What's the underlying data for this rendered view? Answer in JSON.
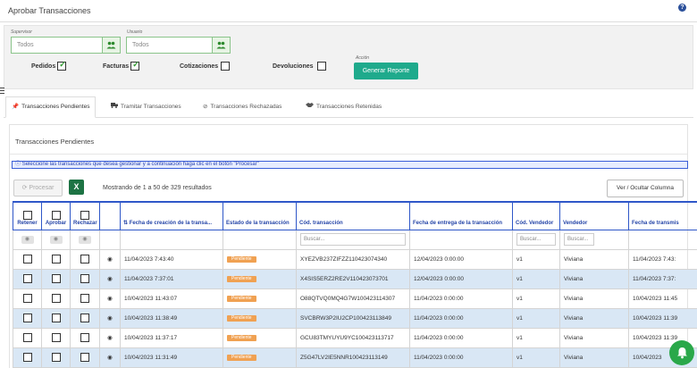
{
  "header": {
    "title": "Aprobar Transacciones",
    "help_glyph": "?"
  },
  "filters": {
    "supervisor": {
      "label": "Supervisor",
      "value": "Todos"
    },
    "usuario": {
      "label": "Usuario",
      "value": "Todos"
    },
    "checks": [
      {
        "label": "Pedidos",
        "checked": true
      },
      {
        "label": "Facturas",
        "checked": true
      },
      {
        "label": "Cotizaciones",
        "checked": false
      },
      {
        "label": "Devoluciones",
        "checked": false
      }
    ],
    "accion_label": "Acción",
    "generar_label": "Generar Reporte"
  },
  "tabs": [
    {
      "label": "Transacciones Pendientes",
      "icon": "pin-icon",
      "active": true
    },
    {
      "label": "Tramitar Transacciones",
      "icon": "truck-icon",
      "active": false
    },
    {
      "label": "Transacciones Rechazadas",
      "icon": "ban-icon",
      "active": false
    },
    {
      "label": "Transacciones Retenidas",
      "icon": "handshake-icon",
      "active": false
    }
  ],
  "panel": {
    "title": "Transacciones Pendientes",
    "info": "Seleccione las transacciones que desea gestionar y a continuación haga clic en el botón \"Procesar\"",
    "procesar_label": "Procesar",
    "excel_glyph": "X",
    "showing": "Mostrando de 1 a 50 de 329 resultados",
    "columns_button": "Ver / Ocultar Columna"
  },
  "table": {
    "headers": {
      "retener": "Retener",
      "aprobar": "Aprobar",
      "rechazar": "Rechazar",
      "fecha_creacion": "Fecha de creación de la transa...",
      "estado": "Estado de la transacción",
      "cod": "Cód. transacción",
      "fecha_entrega": "Fecha de entrega de la transacción",
      "cod_vendedor": "Cód. Vendedor",
      "vendedor": "Vendedor",
      "fecha_transmision": "Fecha de transmis"
    },
    "filter_placeholders": {
      "cod": "Buscar...",
      "cod_vendedor": "Buscar...",
      "vendedor": "Buscar..."
    },
    "rows": [
      {
        "fecha": "11/04/2023 7:43:40",
        "estado": "Pendiente",
        "cod": "XYEZVB237ZIFZZ110423074340",
        "entrega": "12/04/2023 0:00:00",
        "cod_vendedor": "v1",
        "vendedor": "Viviana",
        "transmision": "11/04/2023 7:43:"
      },
      {
        "fecha": "11/04/2023 7:37:01",
        "estado": "Pendiente",
        "cod": "X4SIS5ERZ2RE2V110423073701",
        "entrega": "12/04/2023 0:00:00",
        "cod_vendedor": "v1",
        "vendedor": "Viviana",
        "transmision": "11/04/2023 7:37:"
      },
      {
        "fecha": "10/04/2023 11:43:07",
        "estado": "Pendiente",
        "cod": "O88QTVQ0MQ4G7W100423114307",
        "entrega": "11/04/2023 0:00:00",
        "cod_vendedor": "v1",
        "vendedor": "Viviana",
        "transmision": "10/04/2023 11:45"
      },
      {
        "fecha": "10/04/2023 11:38:49",
        "estado": "Pendiente",
        "cod": "SVCBRW3P2IU2CP100423113849",
        "entrega": "11/04/2023 0:00:00",
        "cod_vendedor": "v1",
        "vendedor": "Viviana",
        "transmision": "10/04/2023 11:39"
      },
      {
        "fecha": "10/04/2023 11:37:17",
        "estado": "Pendiente",
        "cod": "GCU83TMYUYU9YC100423113717",
        "entrega": "11/04/2023 0:00:00",
        "cod_vendedor": "v1",
        "vendedor": "Viviana",
        "transmision": "10/04/2023 11:39"
      },
      {
        "fecha": "10/04/2023 11:31:49",
        "estado": "Pendiente",
        "cod": "Z5G47LV2IE5NNR100423113149",
        "entrega": "11/04/2023 0:00:00",
        "cod_vendedor": "v1",
        "vendedor": "Viviana",
        "transmision": "10/04/2023"
      }
    ]
  },
  "colors": {
    "accent_green": "#1faa8c",
    "header_blue": "#2f57c8",
    "badge_orange": "#f0a152",
    "row_alt": "#d9e7f5",
    "fab_green": "#2aa84a"
  }
}
